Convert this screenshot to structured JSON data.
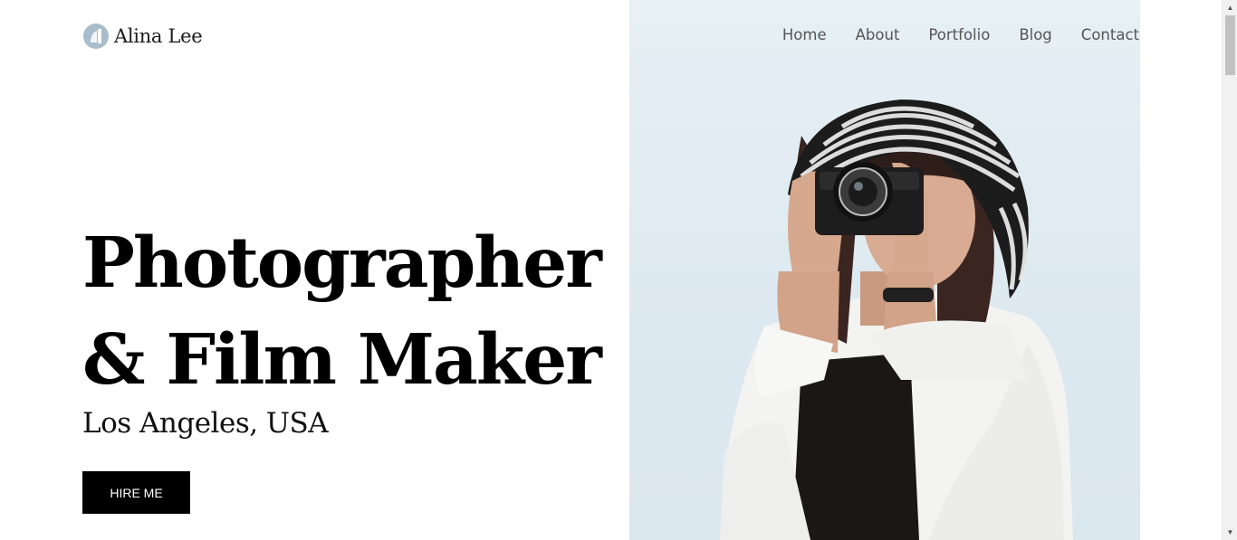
{
  "header": {
    "logo_text": "Alina Lee",
    "nav": [
      "Home",
      "About",
      "Portfolio",
      "Blog",
      "Contact"
    ]
  },
  "hero": {
    "headline_line1": "Photographer",
    "headline_line2": "& Film Maker",
    "location": "Los Angeles, USA",
    "cta_label": "HIRE ME",
    "photo_icon": "woman-with-camera-photo"
  },
  "scrollbar": {
    "up_icon": "scroll-up-arrow-icon",
    "down_icon": "scroll-down-arrow-icon"
  },
  "colors": {
    "accent": "#000000",
    "nav_text": "#555555",
    "photo_background": "#e2edf3"
  }
}
